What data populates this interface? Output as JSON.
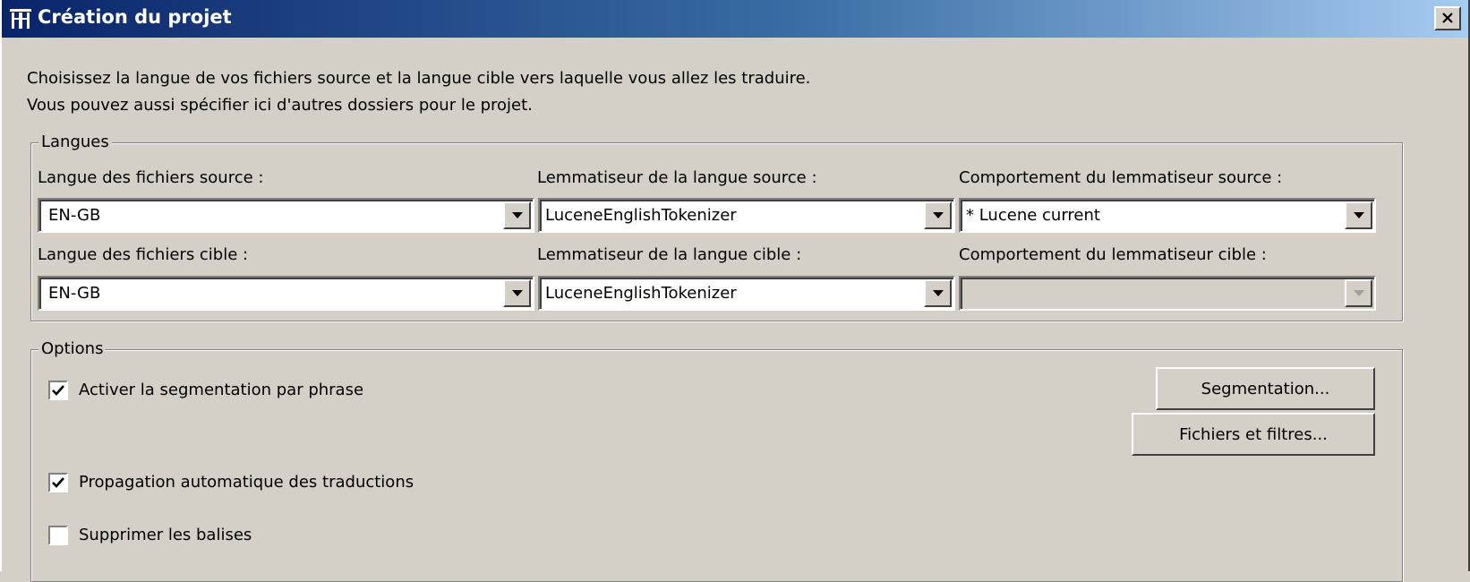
{
  "window": {
    "title": "Création du projet",
    "icon": "omegat-app-icon",
    "close_icon": "close-icon"
  },
  "intro": {
    "line1": "Choisissez la langue de vos fichiers source et la langue cible vers laquelle vous allez les traduire.",
    "line2": "Vous pouvez aussi spécifier ici d'autres dossiers pour le projet."
  },
  "languages": {
    "legend": "Langues",
    "source_lang_label": "Langue des fichiers source :",
    "source_lang_value": "EN-GB",
    "source_tokenizer_label": "Lemmatiseur de la langue source :",
    "source_tokenizer_value": "LuceneEnglishTokenizer",
    "source_behavior_label": "Comportement du lemmatiseur source :",
    "source_behavior_value": "* Lucene current",
    "target_lang_label": "Langue des fichiers cible :",
    "target_lang_value": "EN-GB",
    "target_tokenizer_label": "Lemmatiseur de la langue cible :",
    "target_tokenizer_value": "LuceneEnglishTokenizer",
    "target_behavior_label": "Comportement du lemmatiseur cible :",
    "target_behavior_value": ""
  },
  "options": {
    "legend": "Options",
    "sentence_seg_label": "Activer la segmentation par phrase",
    "sentence_seg_checked": true,
    "auto_propagation_label": "Propagation automatique des traductions",
    "auto_propagation_checked": true,
    "remove_tags_label": "Supprimer les balises",
    "remove_tags_checked": false,
    "segmentation_button": "Segmentation...",
    "files_filters_button": "Fichiers et filtres..."
  }
}
